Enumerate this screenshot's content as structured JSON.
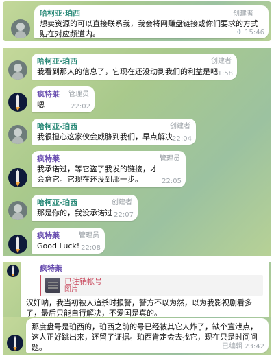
{
  "messages": [
    {
      "sender": "哈柯亚·珀西",
      "role": "创建者",
      "text": "想卖资源的可以直接联系我，我会将网赚盘链接或你们要求的方式贴在对应频道内。",
      "time": "15:46",
      "status_icon": "pin-icon"
    },
    {
      "sender": "哈柯亚·珀西",
      "role": "创建者",
      "text": "我看到那人的信息了，它现在还没动到我们的利益是吧",
      "time": "21:58"
    },
    {
      "sender": "疯特莱",
      "role": "管理员",
      "text": "嗯",
      "time": "22:02"
    },
    {
      "sender": "哈柯亚·珀西",
      "role": "创建者",
      "text": "我很担心这家伙会威胁到我们，早点解决",
      "time": "22:04"
    },
    {
      "sender": "疯特莱",
      "role": "管理员",
      "text": "我承诺过，等它盗了我发的链接，才会盒它。它现在还没到那一步。",
      "time": "22:05"
    },
    {
      "sender": "哈柯亚·珀西",
      "role": "创建者",
      "text": "那是你的，我没承诺过",
      "time": "22:07"
    },
    {
      "sender": "疯特莱",
      "role": "管理员",
      "text": "Good Luck!",
      "time": "22:08"
    },
    {
      "sender": "疯特莱",
      "reply": {
        "title": "已注销帐号",
        "subtitle": "图片"
      },
      "text": "汉奸呐，我当初被人追杀时报警，警方不以为然，以为我影视剧看多了，最后只能自行解决，不爱国是真的。"
    },
    {
      "text": "那度盘号是珀西的，珀西之前的号已经被其它人炸了，缺个宣泄点，这人正好跳出来，还留了证据。珀西肯定会去找它，现在只是时间问题。",
      "status": "已编辑",
      "time": "23:42"
    }
  ]
}
